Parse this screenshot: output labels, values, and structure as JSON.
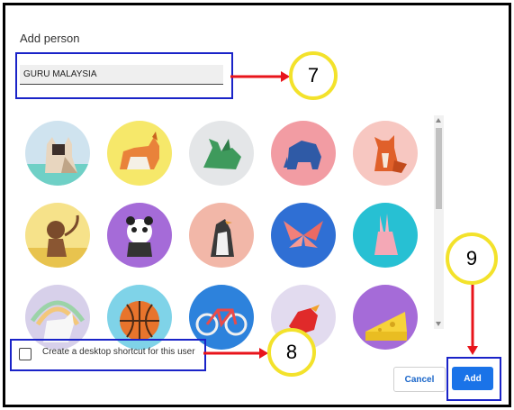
{
  "dialog": {
    "title": "Add person",
    "name_value": "GURU MALAYSIA",
    "shortcut_label": "Create a desktop shortcut for this user",
    "cancel_label": "Cancel",
    "add_label": "Add"
  },
  "avatars": [
    {
      "name": "cat"
    },
    {
      "name": "corgi"
    },
    {
      "name": "dragon"
    },
    {
      "name": "elephant"
    },
    {
      "name": "fox"
    },
    {
      "name": "monkey"
    },
    {
      "name": "panda"
    },
    {
      "name": "penguin"
    },
    {
      "name": "butterfly"
    },
    {
      "name": "rabbit"
    },
    {
      "name": "unicorn"
    },
    {
      "name": "basketball"
    },
    {
      "name": "bicycle"
    },
    {
      "name": "bird"
    },
    {
      "name": "cheese"
    }
  ],
  "callouts": {
    "c7": "7",
    "c8": "8",
    "c9": "9"
  },
  "colors": {
    "annotation_box": "#1a23c8",
    "arrow": "#e8141b",
    "callout_ring": "#f3e22b",
    "primary": "#1a73e8"
  }
}
